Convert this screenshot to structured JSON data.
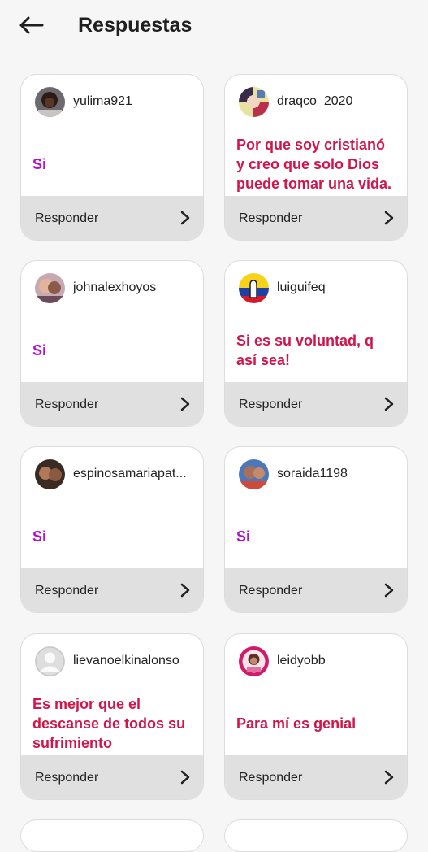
{
  "header": {
    "title": "Respuestas",
    "back_icon": "arrow-left-icon"
  },
  "colors": {
    "purple": "#b10fcf",
    "crimson": "#d1154a"
  },
  "footer_label": "Responder",
  "cards": [
    {
      "username": "yulima921",
      "answer": "Si",
      "answer_color": "#b10fcf"
    },
    {
      "username": "draqco_2020",
      "answer": "Por que soy cristianó y creo que solo Dios puede tomar una vida.",
      "answer_color": "#d1154a"
    },
    {
      "username": "johnalexhoyos",
      "answer": "Si",
      "answer_color": "#b10fcf"
    },
    {
      "username": "luiguifeq",
      "answer": "Si es su voluntad, q así sea!",
      "answer_color": "#d1154a"
    },
    {
      "username": "espinosamariapat...",
      "answer": "Si",
      "answer_color": "#b10fcf"
    },
    {
      "username": "soraida1198",
      "answer": "Si",
      "answer_color": "#b10fcf"
    },
    {
      "username": "lievanoelkinalonso",
      "answer": "Es mejor que el descanse de todos su sufrimiento",
      "answer_color": "#d1154a"
    },
    {
      "username": "leidyobb",
      "answer": "Para mí  es genial",
      "answer_color": "#d1154a"
    }
  ]
}
